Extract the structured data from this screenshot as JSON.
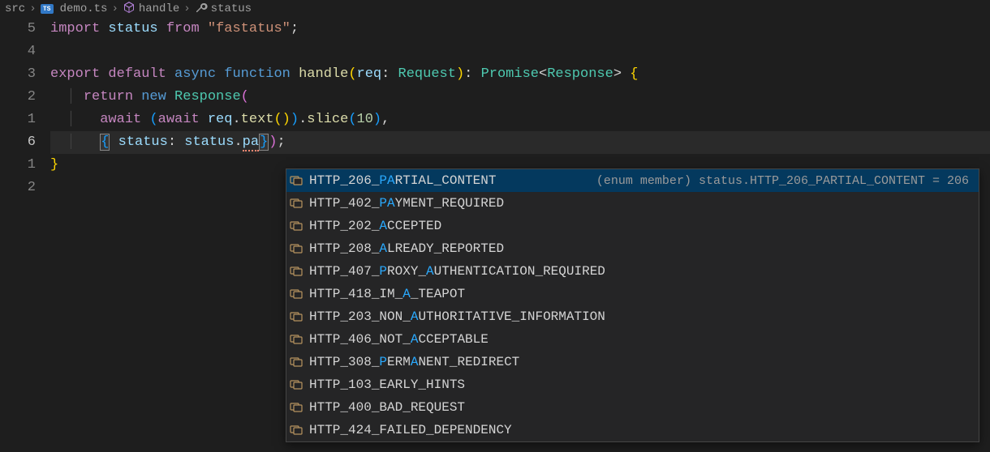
{
  "breadcrumb": {
    "src": "src",
    "file": "demo.ts",
    "method": "handle",
    "prop": "status"
  },
  "gutter": [
    "5",
    "4",
    "3",
    "2",
    "1",
    "6",
    "1",
    "2"
  ],
  "currentLineIndex": 5,
  "code": {
    "line0": {
      "import": "import",
      "status": "status",
      "from": "from",
      "str": "\"fastatus\"",
      "semi": ";"
    },
    "line2": {
      "export": "export",
      "default": "default",
      "async": "async",
      "function": "function",
      "handle": "handle",
      "req": "req",
      "Request": "Request",
      "Promise": "Promise",
      "Response": "Response"
    },
    "line3": {
      "return": "return",
      "new": "new",
      "Response": "Response"
    },
    "line4": {
      "await1": "await",
      "await2": "await",
      "req": "req",
      "text": "text",
      "slice": "slice",
      "ten": "10"
    },
    "line5": {
      "status1": "status",
      "status2": "status",
      "pa": "pa"
    }
  },
  "autocomplete": {
    "selectedDetail": "(enum member) status.HTTP_206_PARTIAL_CONTENT = 206",
    "items": [
      {
        "pre": "HTTP_206_",
        "match": "PA",
        "post": "RTIAL_CONTENT",
        "selected": true
      },
      {
        "pre": "HTTP_402_",
        "match": "PA",
        "post": "YMENT_REQUIRED"
      },
      {
        "pre": "HTTP_202_",
        "match": "A",
        "post": "CCEPTED"
      },
      {
        "pre": "HTTP_208_",
        "match": "A",
        "post": "LREADY_REPORTED"
      },
      {
        "pre": "HTTP_407_",
        "match": "P",
        "mid": "ROXY_",
        "match2": "A",
        "post": "UTHENTICATION_REQUIRED"
      },
      {
        "pre": "HTTP_418_IM_",
        "match": "A",
        "post": "_TEAPOT"
      },
      {
        "pre": "HTTP_203_NON_",
        "match": "A",
        "post": "UTHORITATIVE_INFORMATION"
      },
      {
        "pre": "HTTP_406_NOT_",
        "match": "A",
        "post": "CCEPTABLE"
      },
      {
        "pre": "HTTP_308_",
        "match": "P",
        "mid": "ERM",
        "match2": "A",
        "post": "NENT_REDIRECT"
      },
      {
        "pre": "HTTP_103_EARLY_HINTS",
        "match": "",
        "post": ""
      },
      {
        "pre": "HTTP_400_BAD_REQUEST",
        "match": "",
        "post": ""
      },
      {
        "pre": "HTTP_424_FAILED_DEPENDENCY",
        "match": "",
        "post": ""
      }
    ]
  }
}
